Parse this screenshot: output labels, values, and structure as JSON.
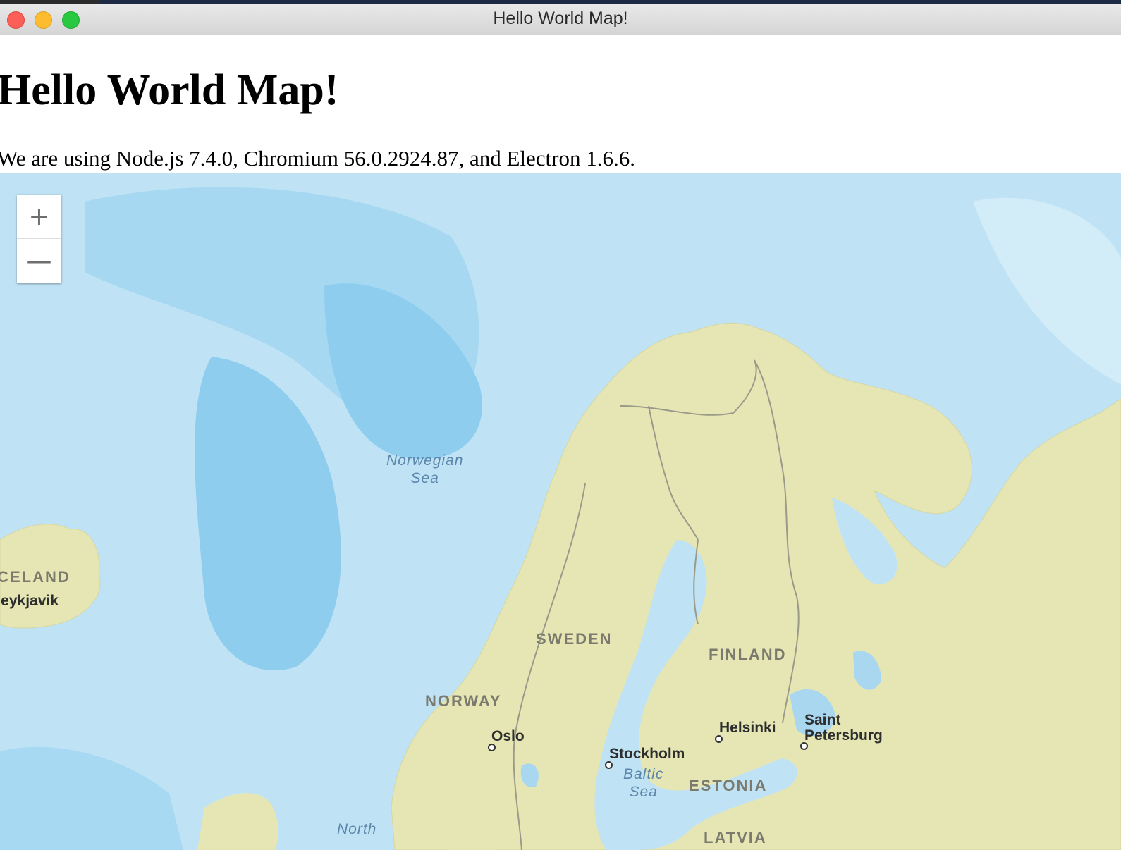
{
  "window": {
    "title": "Hello World Map!"
  },
  "page": {
    "heading": "Hello World Map!",
    "version_text": "We are using Node.js 7.4.0, Chromium 56.0.2924.87, and Electron 1.6.6."
  },
  "map": {
    "zoom_in_label": "+",
    "zoom_out_label": "—",
    "labels": {
      "norwegian_sea": "Norwegian\nSea",
      "iceland": "ICELAND",
      "reykjavik": "Reykjavik",
      "sweden": "SWEDEN",
      "finland": "FINLAND",
      "norway": "NORWAY",
      "oslo": "Oslo",
      "stockholm": "Stockholm",
      "helsinki": "Helsinki",
      "saint_petersburg": "Saint\nPetersburg",
      "baltic_sea": "Baltic\nSea",
      "estonia": "ESTONIA",
      "north_sea": "North",
      "latvia": "LATVIA"
    },
    "colors": {
      "water": "#bfe3f5",
      "deep_water": "#8ccbed",
      "land": "#e6e6b4",
      "border": "#9a9a8a"
    }
  }
}
